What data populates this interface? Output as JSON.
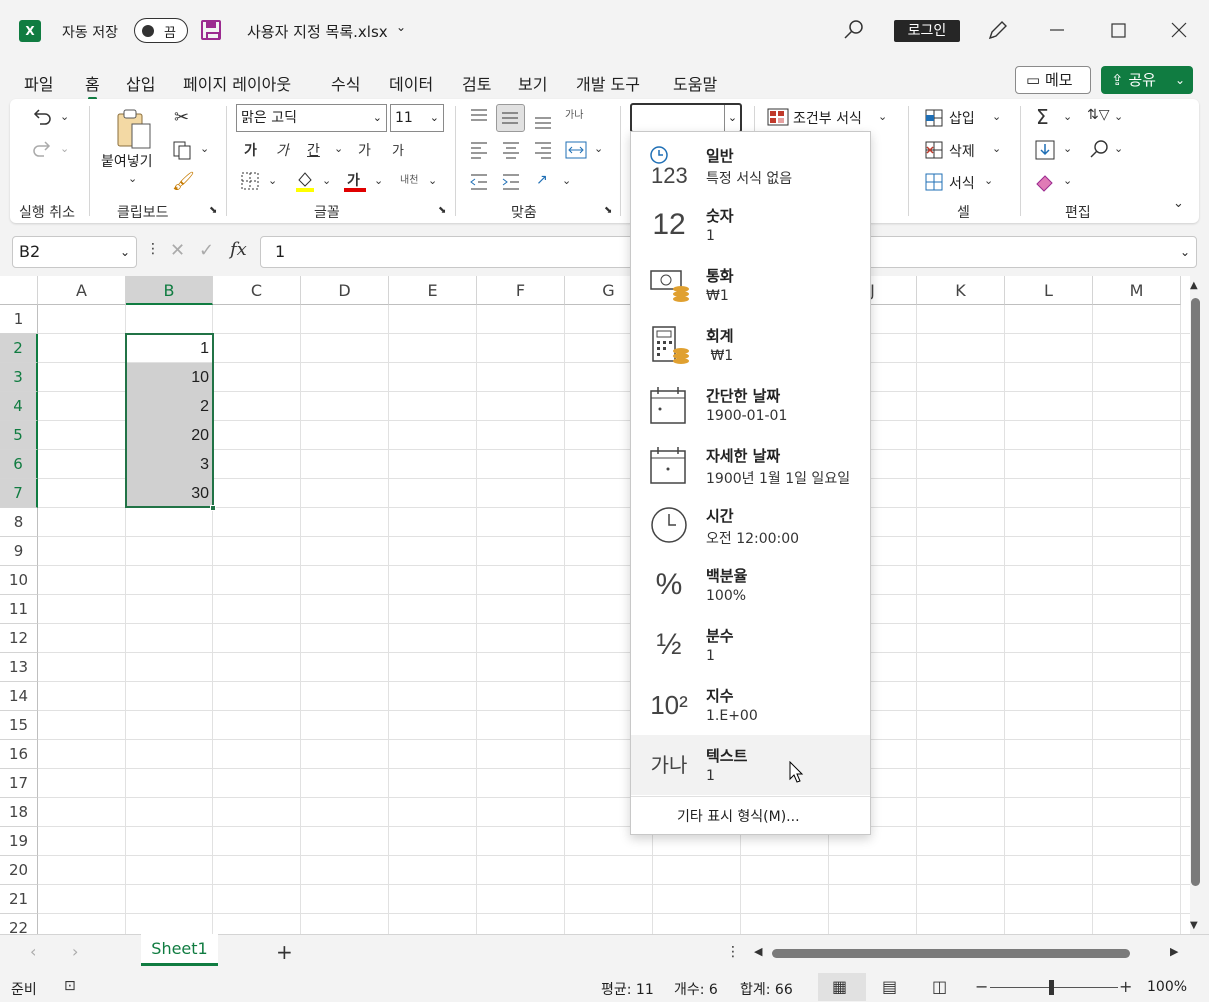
{
  "titlebar": {
    "autosave_label": "자동 저장",
    "autosave_state": "끔",
    "file_name": "사용자 지정 목록.xlsx",
    "login_label": "로그인"
  },
  "tabs": [
    "파일",
    "홈",
    "삽입",
    "페이지 레이아웃",
    "수식",
    "데이터",
    "검토",
    "보기",
    "개발 도구",
    "도움말"
  ],
  "active_tab": "홈",
  "memo_label": "메모",
  "share_label": "공유",
  "ribbon": {
    "undo_group": "실행 취소",
    "clipboard_group": "클립보드",
    "paste_label": "붙여넣기",
    "font_group": "글꼴",
    "font_name": "맑은 고딕",
    "font_size": "11",
    "bold_glyph": "가",
    "italic_glyph": "가",
    "underline_glyph": "간",
    "grow_glyph": "가",
    "shrink_glyph": "가",
    "phonetic_glyph": "내천",
    "wrap_glyph": "가나",
    "fontcolor_glyph": "가",
    "align_group": "맞춤",
    "number_format_value": "",
    "cond_format_label": "조건부 서식",
    "insert_label": "삽입",
    "delete_label": "삭제",
    "format_label": "서식",
    "cells_group": "셀",
    "editing_group": "편집"
  },
  "formula_bar": {
    "name_box": "B2",
    "fx_label": "fx",
    "value": "1"
  },
  "grid": {
    "columns": [
      "A",
      "B",
      "C",
      "D",
      "E",
      "F",
      "G",
      "H",
      "I",
      "J",
      "K",
      "L",
      "M"
    ],
    "rows": [
      "1",
      "2",
      "3",
      "4",
      "5",
      "6",
      "7",
      "8",
      "9",
      "10",
      "11",
      "12",
      "13",
      "14",
      "15",
      "16",
      "17",
      "18",
      "19",
      "20",
      "21",
      "22"
    ],
    "cells": [
      {
        "ref": "B2",
        "value": "1"
      },
      {
        "ref": "B3",
        "value": "10"
      },
      {
        "ref": "B4",
        "value": "2"
      },
      {
        "ref": "B5",
        "value": "20"
      },
      {
        "ref": "B6",
        "value": "3"
      },
      {
        "ref": "B7",
        "value": "30"
      }
    ],
    "selection_color": "#d0d0d0",
    "selection_border": "#217346"
  },
  "number_format_menu": {
    "items": [
      {
        "icon": "clock-123-icon",
        "glyph": "123",
        "title": "일반",
        "sample": "특정 서식 없음"
      },
      {
        "icon": "number-12-icon",
        "glyph": "12",
        "title": "숫자",
        "sample": "1"
      },
      {
        "icon": "currency-icon",
        "glyph": "",
        "title": "통화",
        "sample": "₩1"
      },
      {
        "icon": "accounting-icon",
        "glyph": "",
        "title": "회계",
        "sample": " ₩1"
      },
      {
        "icon": "calendar-short-icon",
        "glyph": "",
        "title": "간단한 날짜",
        "sample": "1900-01-01"
      },
      {
        "icon": "calendar-long-icon",
        "glyph": "",
        "title": "자세한 날짜",
        "sample": "1900년 1월 1일 일요일"
      },
      {
        "icon": "clock-icon",
        "glyph": "",
        "title": "시간",
        "sample": "오전 12:00:00"
      },
      {
        "icon": "percent-icon",
        "glyph": "%",
        "title": "백분율",
        "sample": "100%"
      },
      {
        "icon": "fraction-icon",
        "glyph": "½",
        "title": "분수",
        "sample": "1"
      },
      {
        "icon": "scientific-icon",
        "glyph": "10²",
        "title": "지수",
        "sample": "1.E+00"
      },
      {
        "icon": "text-icon",
        "glyph": "가나",
        "title": "텍스트",
        "sample": "1"
      }
    ],
    "more_label": "기타 표시 형식(M)...",
    "hovered_item": "텍스트"
  },
  "sheet": {
    "tab_name": "Sheet1"
  },
  "status": {
    "ready": "준비",
    "average": "평균: 11",
    "count": "개수: 6",
    "sum": "합계: 66",
    "zoom": "100%"
  },
  "colors": {
    "accent": "#107c41",
    "ribbon_bg": "#ffffff",
    "window_bg": "#f3f3f3"
  }
}
